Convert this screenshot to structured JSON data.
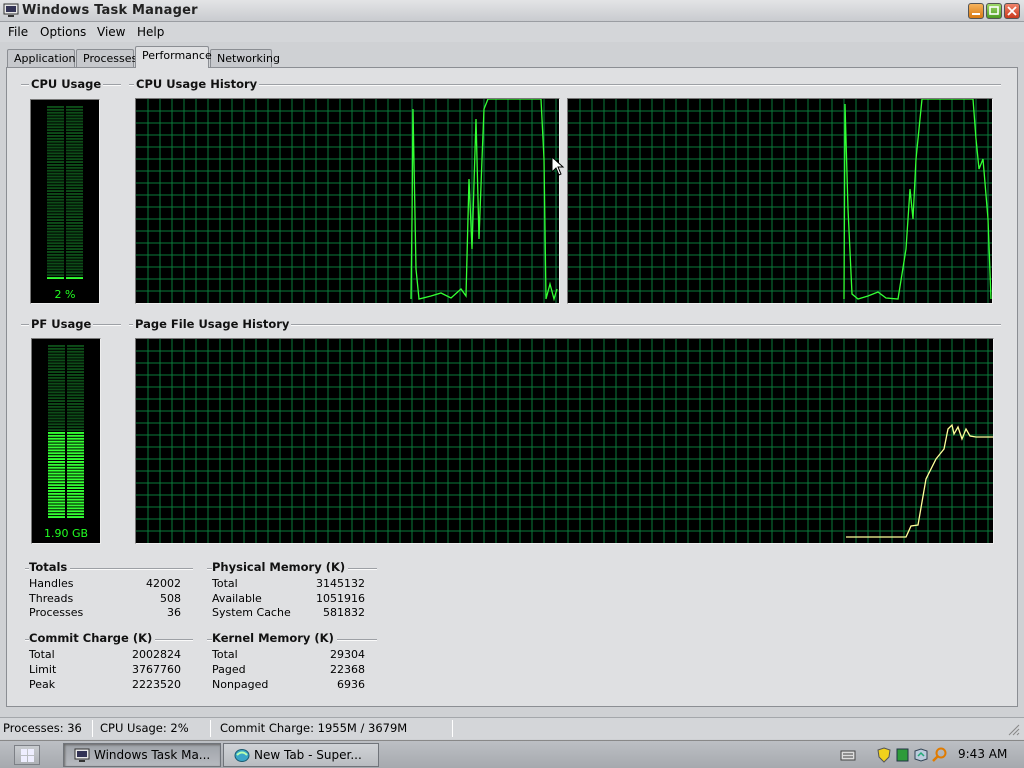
{
  "window": {
    "title": "Windows Task Manager"
  },
  "menu": [
    "File",
    "Options",
    "View",
    "Help"
  ],
  "tabs": [
    "Applications",
    "Processes",
    "Performance",
    "Networking"
  ],
  "active_tab": "Performance",
  "performance": {
    "cpu_usage": {
      "title": "CPU Usage",
      "value": "2 %",
      "percent": 2
    },
    "cpu_history": {
      "title": "CPU Usage History"
    },
    "pf_usage": {
      "title": "PF Usage",
      "value": "1.90 GB",
      "fraction": 0.5
    },
    "pf_history": {
      "title": "Page File Usage History"
    }
  },
  "totals": {
    "title": "Totals",
    "rows": [
      {
        "label": "Handles",
        "value": "42002"
      },
      {
        "label": "Threads",
        "value": "508"
      },
      {
        "label": "Processes",
        "value": "36"
      }
    ]
  },
  "physical_memory": {
    "title": "Physical Memory (K)",
    "rows": [
      {
        "label": "Total",
        "value": "3145132"
      },
      {
        "label": "Available",
        "value": "1051916"
      },
      {
        "label": "System Cache",
        "value": "581832"
      }
    ]
  },
  "commit_charge": {
    "title": "Commit Charge (K)",
    "rows": [
      {
        "label": "Total",
        "value": "2002824"
      },
      {
        "label": "Limit",
        "value": "3767760"
      },
      {
        "label": "Peak",
        "value": "2223520"
      }
    ]
  },
  "kernel_memory": {
    "title": "Kernel Memory (K)",
    "rows": [
      {
        "label": "Total",
        "value": "29304"
      },
      {
        "label": "Paged",
        "value": "22368"
      },
      {
        "label": "Nonpaged",
        "value": "6936"
      }
    ]
  },
  "statusbar": {
    "processes": "Processes: 36",
    "cpu_usage": "CPU Usage: 2%",
    "commit_charge": "Commit Charge: 1955M / 3679M"
  },
  "taskbar": {
    "buttons": [
      {
        "label": "Windows Task Ma...",
        "active": true
      },
      {
        "label": "New Tab - Super...",
        "active": false
      }
    ],
    "clock": "9:43 AM"
  },
  "colors": {
    "graph_bg": "#000000",
    "grid": "#0a7a3a",
    "cpu_line": "#33ff33",
    "pf_line": "#ffff99",
    "meter_on": "#33ff33",
    "meter_off": "#0d4d18"
  }
}
